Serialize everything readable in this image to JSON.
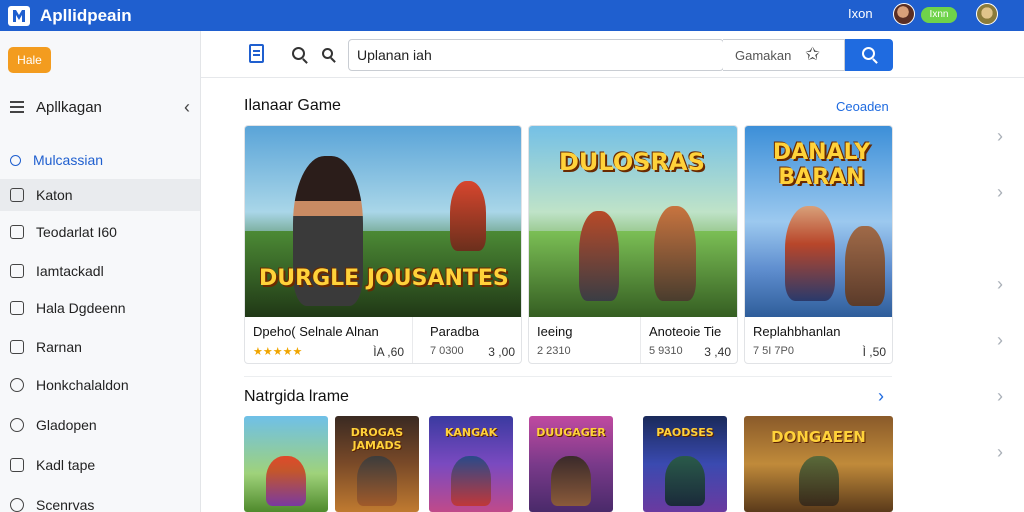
{
  "app": {
    "title": "Apllidpeain",
    "user_name": "Ixon",
    "pill_label": "Ixnn"
  },
  "sidebar": {
    "badge": "Hale",
    "header_label": "Apllkagan",
    "items": [
      {
        "label": "Mulcassian",
        "icon": "search-icon"
      },
      {
        "label": "Katon",
        "icon": "folder-icon"
      },
      {
        "label": "Teodarlat I60",
        "icon": "grid-icon"
      },
      {
        "label": "Iamtackadl",
        "icon": "calendar-icon"
      },
      {
        "label": "Hala Dgdeenn",
        "icon": "message-icon"
      },
      {
        "label": "Rarnan",
        "icon": "box-icon"
      },
      {
        "label": "Honkchalaldon",
        "icon": "clock-icon"
      },
      {
        "label": "Gladopen",
        "icon": "chat-icon"
      },
      {
        "label": "Kadl tape",
        "icon": "edit-icon"
      },
      {
        "label": "Scenrvas",
        "icon": "settings-icon"
      }
    ]
  },
  "search": {
    "placeholder": "Uplanan iah",
    "value": "Uplanan iah",
    "filter_label": "Gamakan"
  },
  "featured": {
    "title": "Ilanaar Game",
    "link": "Ceoaden",
    "banners": [
      "DURGLE JOUSANTES",
      "DULOSRAS",
      "DANALY BARAN"
    ],
    "cards": [
      {
        "name": "Dpeho( Selnale Alnan",
        "stars": "★★★★★",
        "price": "ÌA ,60"
      },
      {
        "name": "Paradba",
        "stat": "7 0300",
        "price": "3 ,00"
      },
      {
        "name": "Ieeing",
        "stat": "2 2310",
        "price": ""
      },
      {
        "name": "Anoteoie Tie",
        "stat": "5 9310",
        "price": "3 ,40"
      },
      {
        "name": "Replahbhanlan",
        "stat": "7 5I 7P0",
        "price": "Ì ,50"
      }
    ]
  },
  "new_games": {
    "title": "Natrgida lrame",
    "thumbs": [
      "",
      "DROGAS JAMADS",
      "KANGAK",
      "DUUGAGER",
      "PAODSES",
      "DONGAEEN"
    ]
  }
}
